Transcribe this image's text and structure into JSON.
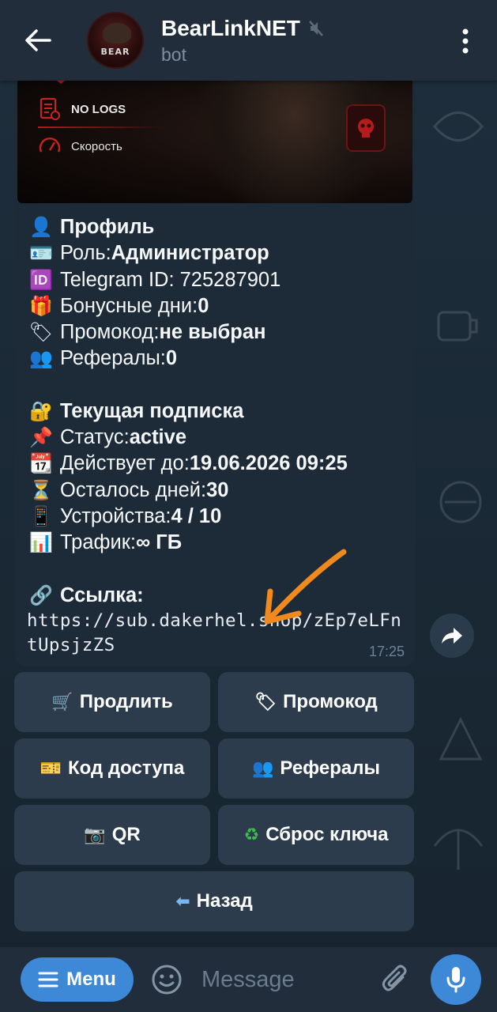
{
  "header": {
    "title": "BearLinkNET",
    "subtitle": "bot",
    "avatar_text": "BEAR",
    "muted_icon": "mute-icon"
  },
  "banner": {
    "item_1": "NO LOGS",
    "item_2": "Скорость"
  },
  "message": {
    "profile_heading": "Профиль",
    "role_label": "Роль: ",
    "role_value": "Администратор",
    "tgid_label": "Telegram ID: 725287901",
    "bonus_label": "Бонусные дни: ",
    "bonus_value": "0",
    "promo_label": "Промокод: ",
    "promo_value": "не выбран",
    "refs_label": "Рефералы: ",
    "refs_value": "0",
    "sub_heading": "Текущая подписка",
    "status_label": "Статус: ",
    "status_value": "active",
    "valid_label": "Действует до: ",
    "valid_value": "19.06.2026 09:25",
    "days_label": "Осталось дней: ",
    "days_value": "30",
    "devices_label": "Устройства: ",
    "devices_value": "4 / 10",
    "traffic_label": "Трафик: ",
    "traffic_value": "∞ ГБ",
    "link_heading": "Ссылка:",
    "link_url": "https://sub.dakerhel.shop/zEp7eLFntUpsjzZS",
    "time": "17:25",
    "emoji": {
      "profile": "👤",
      "role": "🪪",
      "tgid": "🆔",
      "bonus": "🎁",
      "promo": "🏷",
      "refs": "👥",
      "sub": "🔐",
      "status": "📌",
      "valid": "📆",
      "days": "⏳",
      "devices": "📱",
      "traffic": "📊",
      "link": "🔗"
    }
  },
  "keyboard": {
    "extend": "Продлить",
    "promo": "Промокод",
    "access_code": "Код доступа",
    "referrals": "Рефералы",
    "qr": "QR",
    "reset_key": "Сброс ключа",
    "back": "Назад",
    "icons": {
      "extend": "🛒",
      "promo": "🏷",
      "access_code": "🎫",
      "referrals": "👥",
      "qr": "📷",
      "reset_key": "♻",
      "back": "⬅"
    }
  },
  "input": {
    "menu_label": "Menu",
    "placeholder": "Message"
  },
  "colors": {
    "header_bg": "#212d3b",
    "bubble_bg": "#1d2b39",
    "button_bg": "#2c3c4d",
    "accent": "#3e88d8",
    "annotation": "#f08a1c"
  }
}
